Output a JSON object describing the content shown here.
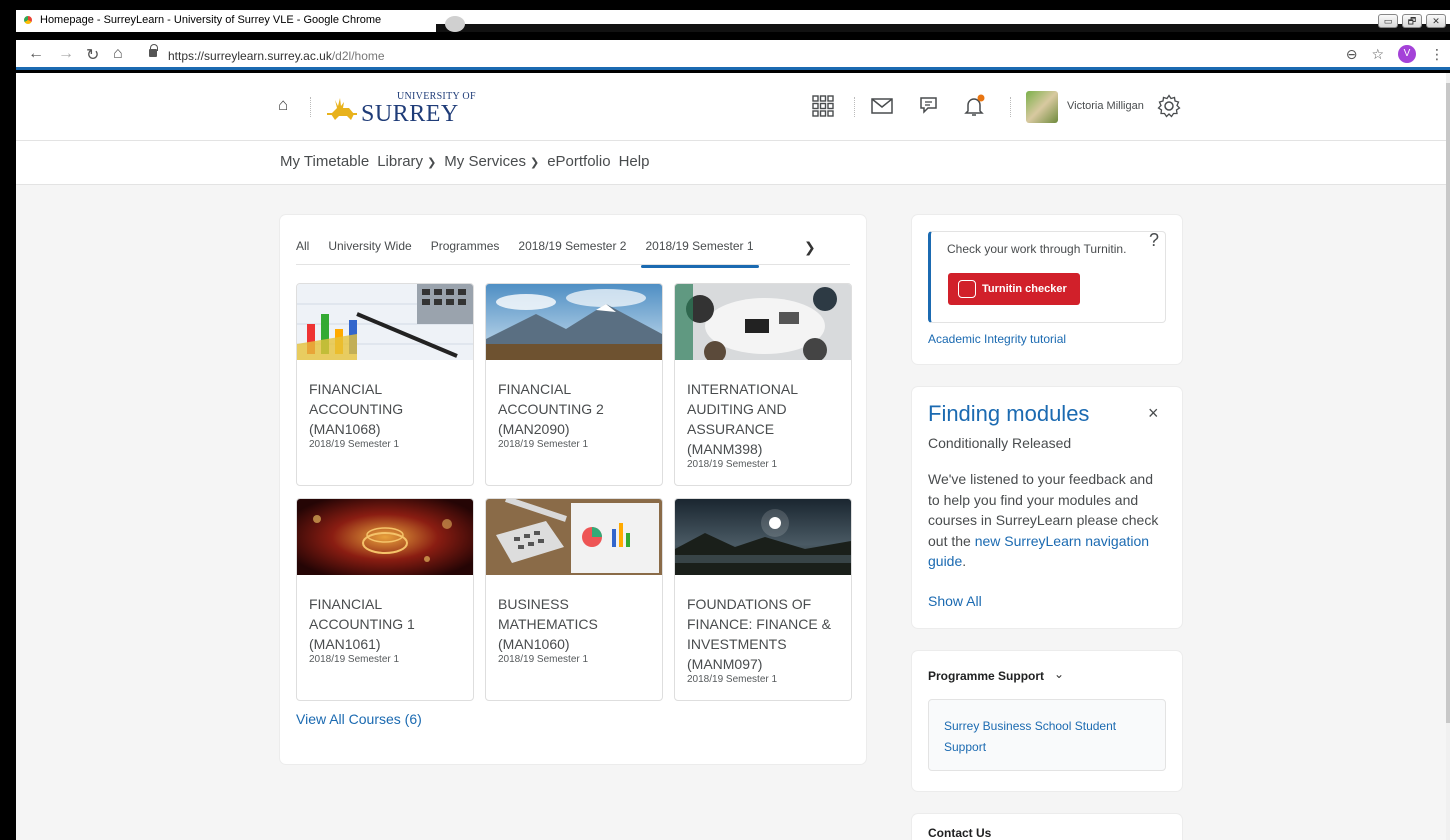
{
  "window": {
    "title": "Homepage - SurreyLearn - University of Surrey VLE - Google Chrome",
    "buttons": [
      "▭",
      "🗗",
      "✕"
    ]
  },
  "address_bar": {
    "url_host": "https://surreylearn.surrey.ac.uk",
    "url_path": "/d2l/home",
    "profile_initial": "V"
  },
  "header": {
    "logo_small": "UNIVERSITY OF",
    "logo_big": "SURREY",
    "user_name": "Victoria Milligan"
  },
  "nav": {
    "items": [
      "My Timetable",
      "Library",
      "My Services",
      "ePortfolio",
      "Help"
    ]
  },
  "courses": {
    "tabs": [
      "All",
      "University Wide",
      "Programmes",
      "2018/19 Semester 2",
      "2018/19 Semester 1"
    ],
    "active_tab": "2018/19 Semester 1",
    "tiles": [
      {
        "name": "FINANCIAL ACCOUNTING (MAN1068)",
        "semester": "2018/19 Semester 1"
      },
      {
        "name": "FINANCIAL ACCOUNTING 2 (MAN2090)",
        "semester": "2018/19 Semester 1"
      },
      {
        "name": "INTERNATIONAL AUDITING AND ASSURANCE (MANM398)",
        "semester": "2018/19 Semester 1"
      },
      {
        "name": "FINANCIAL ACCOUNTING 1 (MAN1061)",
        "semester": "2018/19 Semester 1"
      },
      {
        "name": "BUSINESS MATHEMATICS (MAN1060)",
        "semester": "2018/19 Semester 1"
      },
      {
        "name": "FOUNDATIONS OF FINANCE: FINANCE & INVESTMENTS (MANM097)",
        "semester": "2018/19 Semester 1"
      }
    ],
    "view_all": "View All Courses (6)"
  },
  "turnitin": {
    "text": "Check your work through Turnitin.",
    "help": "?",
    "button": "Turnitin checker",
    "link": "Academic Integrity tutorial"
  },
  "finding_modules": {
    "title": "Finding modules",
    "close": "×",
    "subtitle": "Conditionally Released",
    "body_pre": "We've listened to your feedback and to help you find your modules and courses in SurreyLearn please check out the",
    "body_link": "new SurreyLearn navigation guide",
    "body_post": ".",
    "show_all": "Show All"
  },
  "programme_support": {
    "title": "Programme Support",
    "link": "Surrey Business School Student Support"
  },
  "contact": {
    "title": "Contact Us"
  },
  "colors": {
    "accent": "#1b6ab1",
    "turnitin_red": "#d1202a",
    "logo_navy": "#1f3c78",
    "logo_gold": "#e8b21c"
  }
}
